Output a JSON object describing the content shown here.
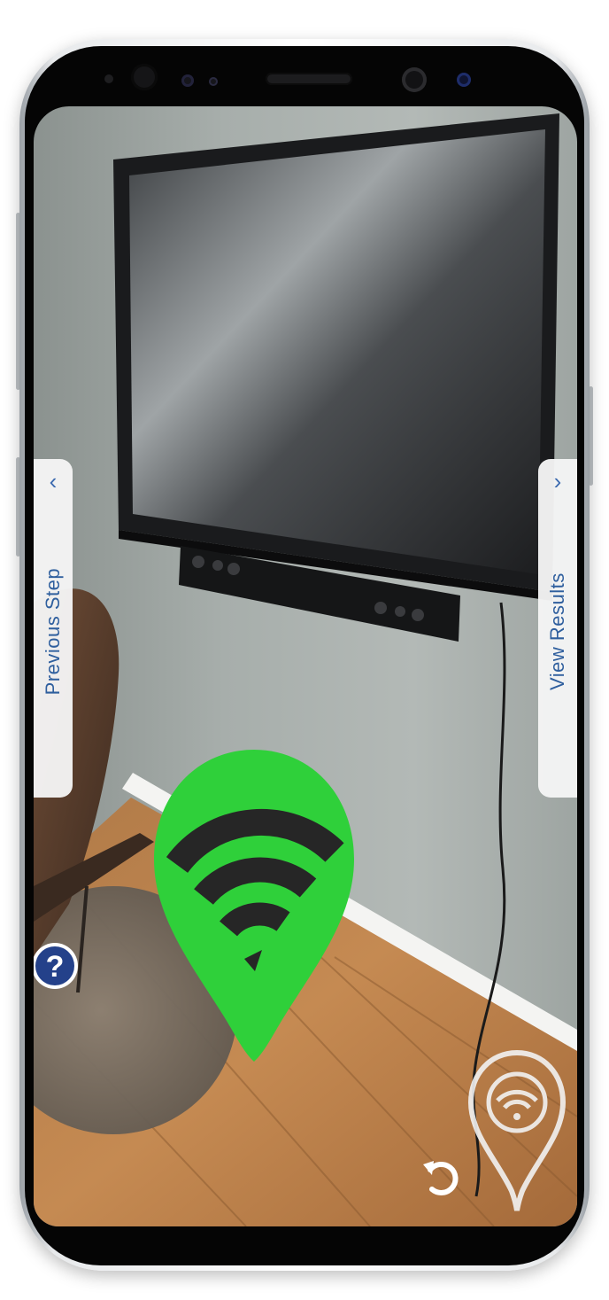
{
  "navigation": {
    "previous_label": "Previous Step",
    "previous_chevron": "‹",
    "next_label": "View Results",
    "next_chevron": "›"
  },
  "help": {
    "glyph": "?"
  },
  "icons": {
    "signal_pin": "wifi-location-pin-icon",
    "ghost_pin": "wifi-location-pin-outline-icon",
    "reset": "undo-icon",
    "help": "question-mark-icon"
  },
  "colors": {
    "pin_green": "#2fd03a",
    "tab_text": "#2f5f9e",
    "help_blue": "#24418a"
  }
}
